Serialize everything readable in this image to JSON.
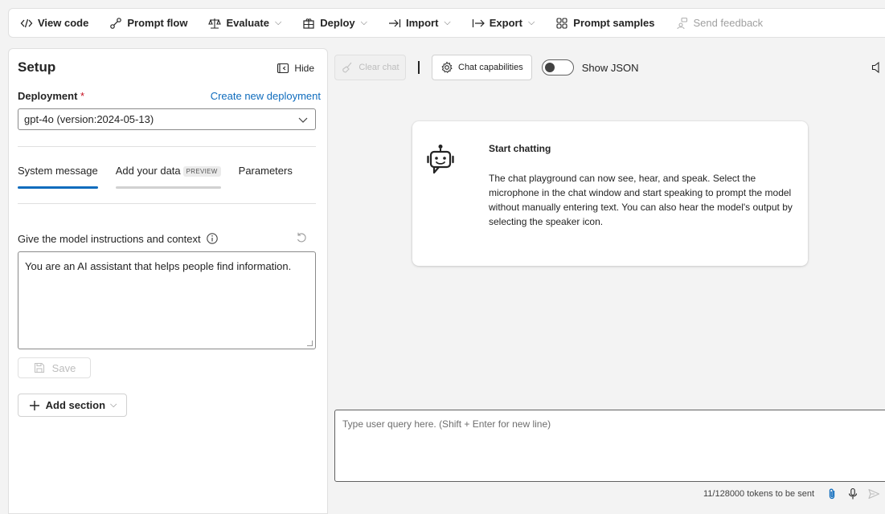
{
  "toolbar": {
    "view_code": "View code",
    "prompt_flow": "Prompt flow",
    "evaluate": "Evaluate",
    "deploy": "Deploy",
    "import": "Import",
    "export": "Export",
    "prompt_samples": "Prompt samples",
    "send_feedback": "Send feedback",
    "chevron": "⌵"
  },
  "setup": {
    "title": "Setup",
    "hide_label": "Hide",
    "deployment_label": "Deployment",
    "required_mark": "*",
    "create_link": "Create new deployment",
    "deployment_value": "gpt-4o (version:2024-05-13)",
    "tabs": [
      {
        "label": "System message"
      },
      {
        "label": "Add your data",
        "badge": "PREVIEW"
      },
      {
        "label": "Parameters"
      }
    ],
    "instructions_label": "Give the model instructions and context",
    "system_message": "You are an AI assistant that helps people find information.",
    "save_label": "Save",
    "add_section_label": "Add section"
  },
  "chat": {
    "clear_chat": "Clear chat",
    "chat_capabilities": "Chat capabilities",
    "show_json": "Show JSON",
    "show_json_on": false,
    "card_title": "Start chatting",
    "card_body": "The chat playground can now see, hear, and speak. Select the microphone in the chat window and start speaking to prompt the model without manually entering text. You can also hear the model's output by selecting the speaker icon.",
    "input_placeholder": "Type user query here. (Shift + Enter for new line)",
    "tokens": "11/128000 tokens to be sent"
  },
  "colors": {
    "accent": "#0f6cbd",
    "required": "#c50f1f",
    "attach": "#0f6cbd"
  }
}
